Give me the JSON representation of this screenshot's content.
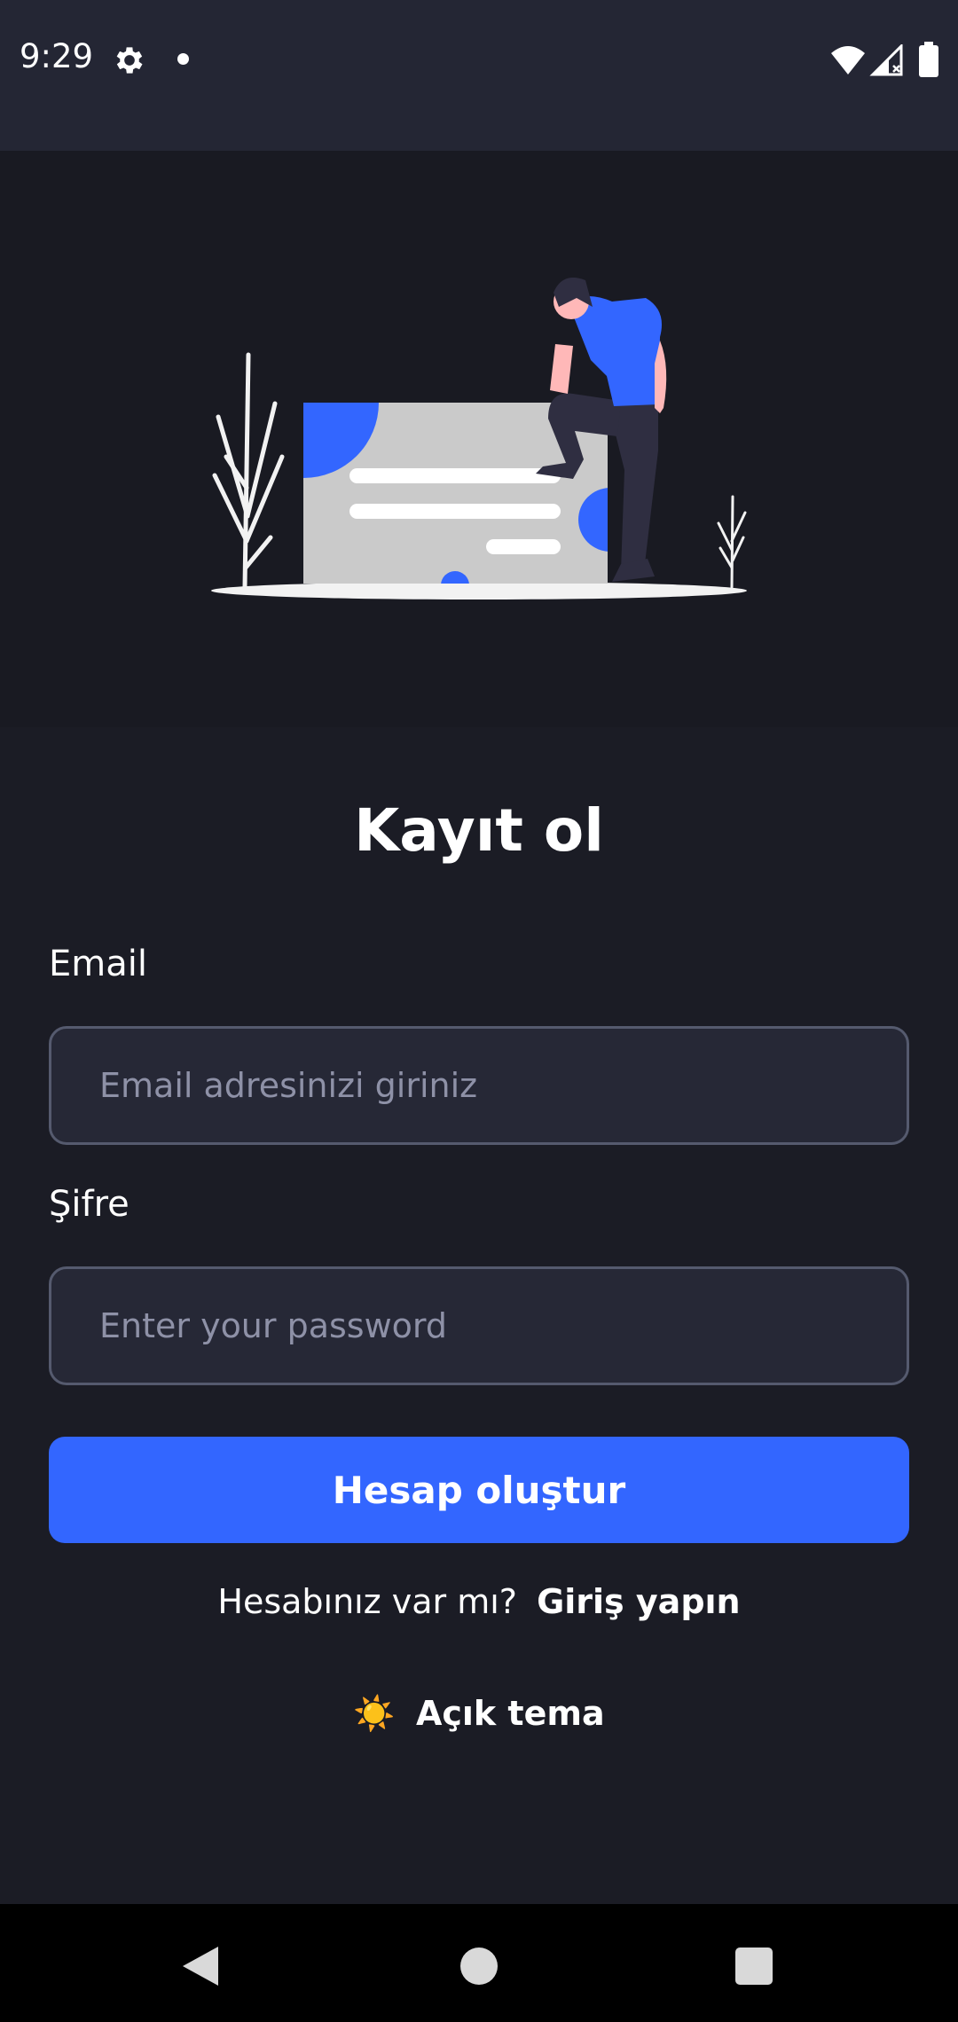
{
  "status_bar": {
    "time": "9:29",
    "icons": [
      "gear-icon",
      "notification-dot-icon",
      "wifi-icon",
      "signal-icon",
      "battery-icon"
    ]
  },
  "hero": {
    "illustration": "person-leaning-on-card-illustration",
    "colors": {
      "accent": "#3366ff",
      "card": "#cacaca",
      "ground": "#f2f2f2"
    }
  },
  "form": {
    "title": "Kayıt ol",
    "email": {
      "label": "Email",
      "placeholder": "Email adresinizi giriniz",
      "value": ""
    },
    "password": {
      "label": "Şifre",
      "placeholder": "Enter your password",
      "value": ""
    },
    "submit_label": "Hesap oluştur"
  },
  "login_prompt": {
    "text": "Hesabınız var mı?",
    "link": "Giriş yapın"
  },
  "theme_toggle": {
    "icon": "☀️",
    "label": "Açık tema"
  },
  "nav_bar": {
    "buttons": [
      "back-icon",
      "home-icon",
      "recents-icon"
    ]
  },
  "colors": {
    "background": "#1b1c25",
    "status_bar": "#242634",
    "input_bg": "#262836",
    "input_border": "#555a6e",
    "primary": "#3366ff",
    "placeholder": "#8e91a7"
  }
}
